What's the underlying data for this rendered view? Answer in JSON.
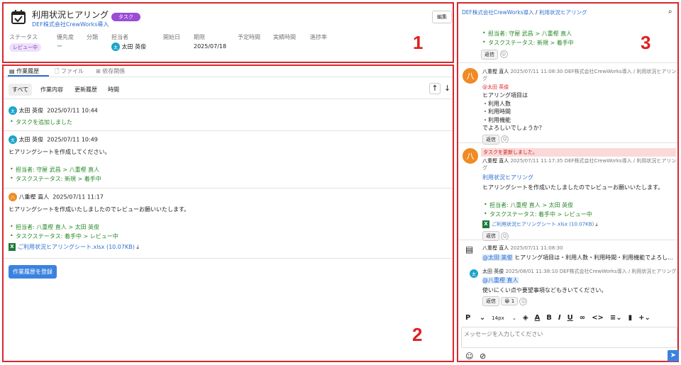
{
  "header": {
    "title": "利用状況ヒアリング",
    "badge": "タスク",
    "project": "DEF株式会社CrewWorks導入",
    "edit": "編集",
    "fields": {
      "status": "ステータス",
      "priority": "優先度",
      "category": "分類",
      "assignee": "担当者",
      "start": "開始日",
      "due": "期限",
      "planned": "予定時間",
      "actual": "実績時間",
      "progress": "進捗率"
    },
    "values": {
      "status": "レビュー中",
      "priority": "ー",
      "assignee_avatar": "太",
      "assignee": "太田 英俊",
      "due": "2025/07/18"
    }
  },
  "tabs": {
    "history": "作業履歴",
    "file": "ファイル",
    "deps": "依存関係"
  },
  "filters": {
    "all": "すべて",
    "content": "作業内容",
    "update": "更新履歴",
    "time": "時間"
  },
  "history": [
    {
      "avatar": "太",
      "user": "太田 英俊",
      "time": "2025/07/11 10:44",
      "bullets": [
        "タスクを追加しました"
      ]
    },
    {
      "avatar": "太",
      "user": "太田 英俊",
      "time": "2025/07/11 10:49",
      "text": "ヒアリングシートを作成してください。",
      "bullets": [
        "担当者: 守屋 武昌 > 八重樫 直人",
        "タスクステータス: 新規 > 着手中"
      ]
    },
    {
      "avatar": "八",
      "user": "八重樫 直人",
      "time": "2025/07/11 11:17",
      "text": "ヒアリングシートを作成いたしましたのでレビューお願いいたします。",
      "bullets": [
        "担当者: 八重樫 直人 > 太田 英俊",
        "タスクステータス: 着手中 > レビュー中"
      ],
      "file": "ご利用状況ヒアリングシート.xlsx (10.07KB)"
    }
  ],
  "register_btn": "作業履歴を登録",
  "chat": {
    "breadcrumb_project": "DEF株式会社CrewWorks導入",
    "breadcrumb_sep": "/",
    "breadcrumb_task": "利用状況ヒアリング",
    "top_bullets": [
      "担当者: 守屋 武昌 > 八重樫 直人",
      "タスクステータス: 新規 > 着手中"
    ],
    "reply": "返信",
    "msg1": {
      "avatar": "八",
      "user": "八重樫 直人",
      "time": "2025/07/11 11:08:30",
      "path": "DEF株式会社CrewWorks導入 / 利用状況ヒアリング",
      "mention": "@太田 英俊",
      "lines": [
        "ヒアリング項目は",
        "・利用人数",
        "・利用時間",
        "・利用機能",
        "でよろしいでしょうか？"
      ]
    },
    "msg2": {
      "banner": "タスクを更新しました。",
      "avatar": "八",
      "user": "八重樫 直人",
      "time": "2025/07/11 11:17:35",
      "path": "DEF株式会社CrewWorks導入 / 利用状況ヒアリング",
      "link": "利用状況ヒアリング",
      "text": "ヒアリングシートを作成いたしましたのでレビューお願いいたします。",
      "bullets": [
        "担当者: 八重樫 直人 > 太田 英俊",
        "タスクステータス: 着手中 > レビュー中"
      ],
      "file": "ご利用状況ヒアリングシート.xlsx (10.07KB)"
    },
    "msg3": {
      "user": "八重樫 直人",
      "time": "2025/07/11 11:08:30",
      "mention": "@太田 英俊",
      "text": "ヒアリング項目は・利用人数・利用時間・利用機能でよろし..."
    },
    "msg4": {
      "avatar": "太",
      "user": "太田 英俊",
      "time": "2025/08/01 11:38:10",
      "path": "DEF株式会社CrewWorks導入 / 利用状況ヒアリング",
      "mention": "@八重樫 直人",
      "text": "使いにくい点や要望事項などもきいてください。",
      "reaction": "😀 1"
    },
    "toolbar": {
      "para": "P",
      "size": "14px"
    },
    "placeholder": "メッセージを入力してください"
  },
  "labels": {
    "one": "1",
    "two": "2",
    "three": "3"
  }
}
